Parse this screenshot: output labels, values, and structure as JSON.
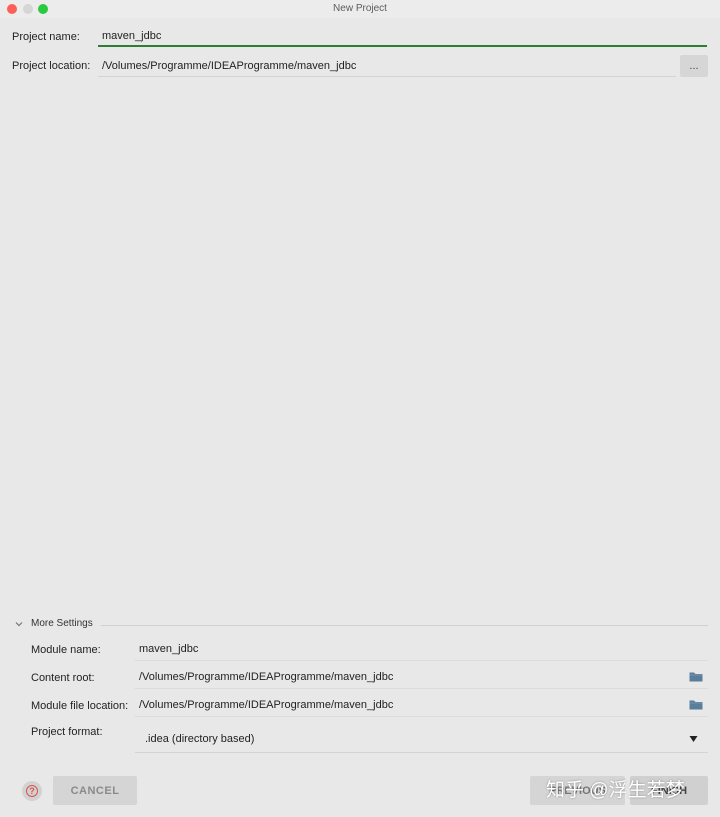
{
  "window": {
    "title": "New Project"
  },
  "form": {
    "project_name_label": "Project name:",
    "project_name_value": "maven_jdbc",
    "project_location_label": "Project location:",
    "project_location_value": "/Volumes/Programme/IDEAProgramme/maven_jdbc",
    "browse_label": "..."
  },
  "more_settings": {
    "title": "More Settings",
    "expanded": true,
    "module_name_label": "Module name:",
    "module_name_value": "maven_jdbc",
    "content_root_label": "Content root:",
    "content_root_value": "/Volumes/Programme/IDEAProgramme/maven_jdbc",
    "module_file_location_label": "Module file location:",
    "module_file_location_value": "/Volumes/Programme/IDEAProgramme/maven_jdbc",
    "project_format_label": "Project format:",
    "project_format_value": ".idea (directory based)"
  },
  "footer": {
    "cancel_label": "CANCEL",
    "previous_label": "PREVIOUS",
    "finish_label": "FINISH",
    "help_glyph": "?"
  },
  "watermark": {
    "text": "知乎 @浮生若梦"
  },
  "colors": {
    "background": "#e8e8e8",
    "focus_underline": "#2f7d32",
    "traffic_close": "#fc5f57",
    "traffic_max": "#2ac940",
    "folder_icon": "#5a7d99"
  },
  "icons": {
    "close": "traffic-close-icon",
    "minimize": "traffic-minimize-icon",
    "maximize": "traffic-maximize-icon",
    "section_toggle": "chevron-down-icon",
    "folder": "folder-icon",
    "dropdown": "triangle-down-icon",
    "help": "help-icon"
  }
}
